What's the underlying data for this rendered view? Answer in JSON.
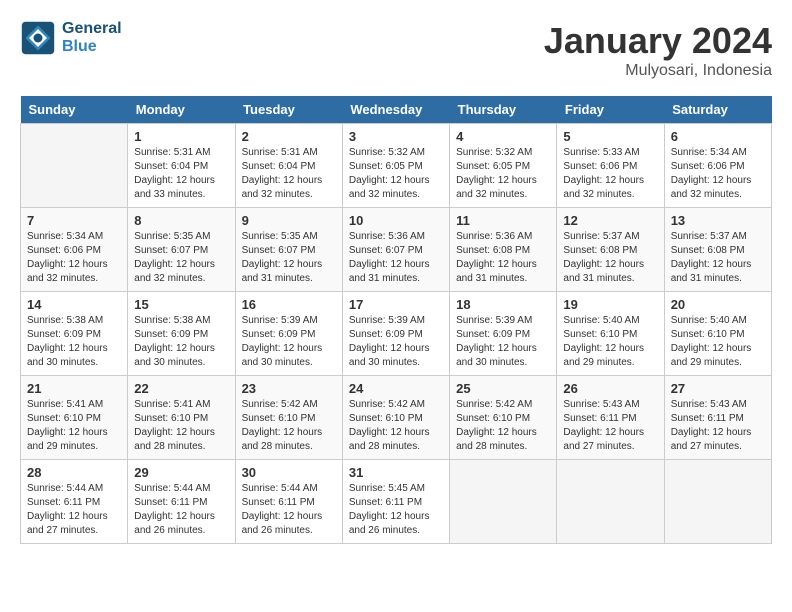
{
  "header": {
    "logo_line1": "General",
    "logo_line2": "Blue",
    "month": "January 2024",
    "location": "Mulyosari, Indonesia"
  },
  "weekdays": [
    "Sunday",
    "Monday",
    "Tuesday",
    "Wednesday",
    "Thursday",
    "Friday",
    "Saturday"
  ],
  "weeks": [
    [
      {
        "day": "",
        "sunrise": "",
        "sunset": "",
        "daylight": ""
      },
      {
        "day": "1",
        "sunrise": "Sunrise: 5:31 AM",
        "sunset": "Sunset: 6:04 PM",
        "daylight": "Daylight: 12 hours and 33 minutes."
      },
      {
        "day": "2",
        "sunrise": "Sunrise: 5:31 AM",
        "sunset": "Sunset: 6:04 PM",
        "daylight": "Daylight: 12 hours and 32 minutes."
      },
      {
        "day": "3",
        "sunrise": "Sunrise: 5:32 AM",
        "sunset": "Sunset: 6:05 PM",
        "daylight": "Daylight: 12 hours and 32 minutes."
      },
      {
        "day": "4",
        "sunrise": "Sunrise: 5:32 AM",
        "sunset": "Sunset: 6:05 PM",
        "daylight": "Daylight: 12 hours and 32 minutes."
      },
      {
        "day": "5",
        "sunrise": "Sunrise: 5:33 AM",
        "sunset": "Sunset: 6:06 PM",
        "daylight": "Daylight: 12 hours and 32 minutes."
      },
      {
        "day": "6",
        "sunrise": "Sunrise: 5:34 AM",
        "sunset": "Sunset: 6:06 PM",
        "daylight": "Daylight: 12 hours and 32 minutes."
      }
    ],
    [
      {
        "day": "7",
        "sunrise": "Sunrise: 5:34 AM",
        "sunset": "Sunset: 6:06 PM",
        "daylight": "Daylight: 12 hours and 32 minutes."
      },
      {
        "day": "8",
        "sunrise": "Sunrise: 5:35 AM",
        "sunset": "Sunset: 6:07 PM",
        "daylight": "Daylight: 12 hours and 32 minutes."
      },
      {
        "day": "9",
        "sunrise": "Sunrise: 5:35 AM",
        "sunset": "Sunset: 6:07 PM",
        "daylight": "Daylight: 12 hours and 31 minutes."
      },
      {
        "day": "10",
        "sunrise": "Sunrise: 5:36 AM",
        "sunset": "Sunset: 6:07 PM",
        "daylight": "Daylight: 12 hours and 31 minutes."
      },
      {
        "day": "11",
        "sunrise": "Sunrise: 5:36 AM",
        "sunset": "Sunset: 6:08 PM",
        "daylight": "Daylight: 12 hours and 31 minutes."
      },
      {
        "day": "12",
        "sunrise": "Sunrise: 5:37 AM",
        "sunset": "Sunset: 6:08 PM",
        "daylight": "Daylight: 12 hours and 31 minutes."
      },
      {
        "day": "13",
        "sunrise": "Sunrise: 5:37 AM",
        "sunset": "Sunset: 6:08 PM",
        "daylight": "Daylight: 12 hours and 31 minutes."
      }
    ],
    [
      {
        "day": "14",
        "sunrise": "Sunrise: 5:38 AM",
        "sunset": "Sunset: 6:09 PM",
        "daylight": "Daylight: 12 hours and 30 minutes."
      },
      {
        "day": "15",
        "sunrise": "Sunrise: 5:38 AM",
        "sunset": "Sunset: 6:09 PM",
        "daylight": "Daylight: 12 hours and 30 minutes."
      },
      {
        "day": "16",
        "sunrise": "Sunrise: 5:39 AM",
        "sunset": "Sunset: 6:09 PM",
        "daylight": "Daylight: 12 hours and 30 minutes."
      },
      {
        "day": "17",
        "sunrise": "Sunrise: 5:39 AM",
        "sunset": "Sunset: 6:09 PM",
        "daylight": "Daylight: 12 hours and 30 minutes."
      },
      {
        "day": "18",
        "sunrise": "Sunrise: 5:39 AM",
        "sunset": "Sunset: 6:09 PM",
        "daylight": "Daylight: 12 hours and 30 minutes."
      },
      {
        "day": "19",
        "sunrise": "Sunrise: 5:40 AM",
        "sunset": "Sunset: 6:10 PM",
        "daylight": "Daylight: 12 hours and 29 minutes."
      },
      {
        "day": "20",
        "sunrise": "Sunrise: 5:40 AM",
        "sunset": "Sunset: 6:10 PM",
        "daylight": "Daylight: 12 hours and 29 minutes."
      }
    ],
    [
      {
        "day": "21",
        "sunrise": "Sunrise: 5:41 AM",
        "sunset": "Sunset: 6:10 PM",
        "daylight": "Daylight: 12 hours and 29 minutes."
      },
      {
        "day": "22",
        "sunrise": "Sunrise: 5:41 AM",
        "sunset": "Sunset: 6:10 PM",
        "daylight": "Daylight: 12 hours and 28 minutes."
      },
      {
        "day": "23",
        "sunrise": "Sunrise: 5:42 AM",
        "sunset": "Sunset: 6:10 PM",
        "daylight": "Daylight: 12 hours and 28 minutes."
      },
      {
        "day": "24",
        "sunrise": "Sunrise: 5:42 AM",
        "sunset": "Sunset: 6:10 PM",
        "daylight": "Daylight: 12 hours and 28 minutes."
      },
      {
        "day": "25",
        "sunrise": "Sunrise: 5:42 AM",
        "sunset": "Sunset: 6:10 PM",
        "daylight": "Daylight: 12 hours and 28 minutes."
      },
      {
        "day": "26",
        "sunrise": "Sunrise: 5:43 AM",
        "sunset": "Sunset: 6:11 PM",
        "daylight": "Daylight: 12 hours and 27 minutes."
      },
      {
        "day": "27",
        "sunrise": "Sunrise: 5:43 AM",
        "sunset": "Sunset: 6:11 PM",
        "daylight": "Daylight: 12 hours and 27 minutes."
      }
    ],
    [
      {
        "day": "28",
        "sunrise": "Sunrise: 5:44 AM",
        "sunset": "Sunset: 6:11 PM",
        "daylight": "Daylight: 12 hours and 27 minutes."
      },
      {
        "day": "29",
        "sunrise": "Sunrise: 5:44 AM",
        "sunset": "Sunset: 6:11 PM",
        "daylight": "Daylight: 12 hours and 26 minutes."
      },
      {
        "day": "30",
        "sunrise": "Sunrise: 5:44 AM",
        "sunset": "Sunset: 6:11 PM",
        "daylight": "Daylight: 12 hours and 26 minutes."
      },
      {
        "day": "31",
        "sunrise": "Sunrise: 5:45 AM",
        "sunset": "Sunset: 6:11 PM",
        "daylight": "Daylight: 12 hours and 26 minutes."
      },
      {
        "day": "",
        "sunrise": "",
        "sunset": "",
        "daylight": ""
      },
      {
        "day": "",
        "sunrise": "",
        "sunset": "",
        "daylight": ""
      },
      {
        "day": "",
        "sunrise": "",
        "sunset": "",
        "daylight": ""
      }
    ]
  ]
}
